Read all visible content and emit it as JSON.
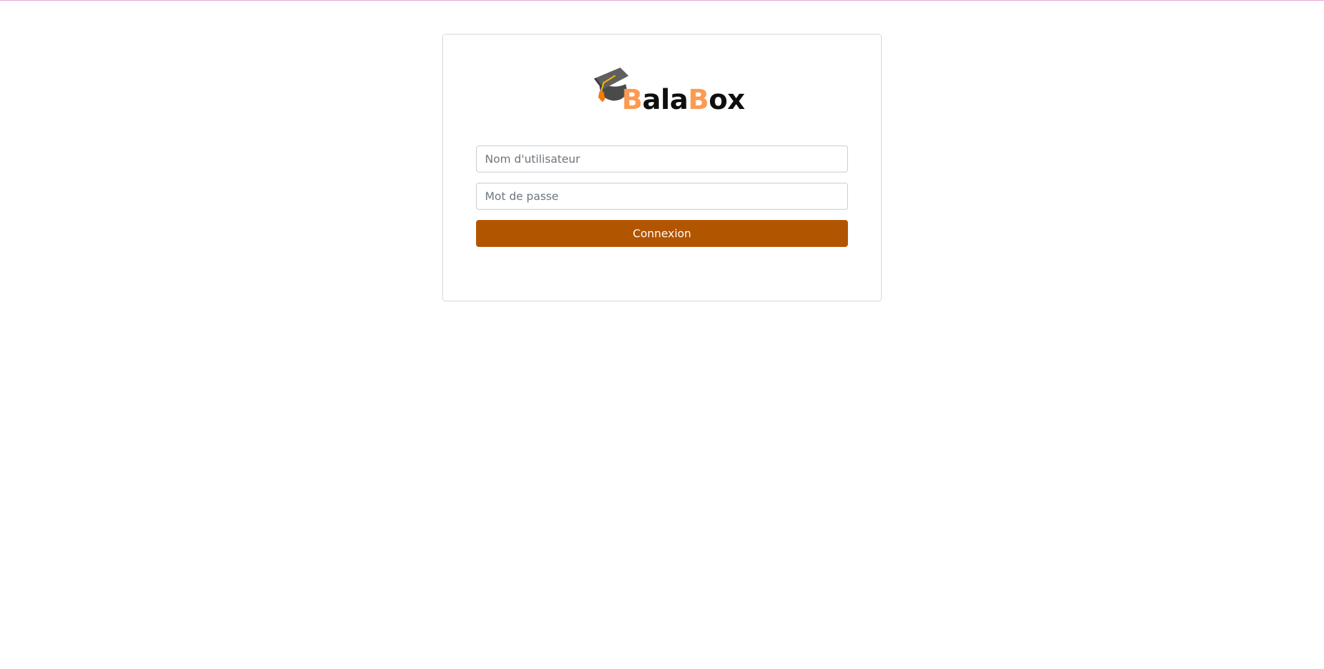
{
  "logo": {
    "text_part1_accent": "B",
    "text_part1": "ala",
    "text_part2_accent": "B",
    "text_part2": "ox",
    "icon": "graduation-cap-icon",
    "accent_color": "#fc9a52"
  },
  "form": {
    "username_placeholder": "Nom d'utilisateur",
    "password_placeholder": "Mot de passe",
    "submit_label": "Connexion",
    "submit_color": "#b25500"
  }
}
